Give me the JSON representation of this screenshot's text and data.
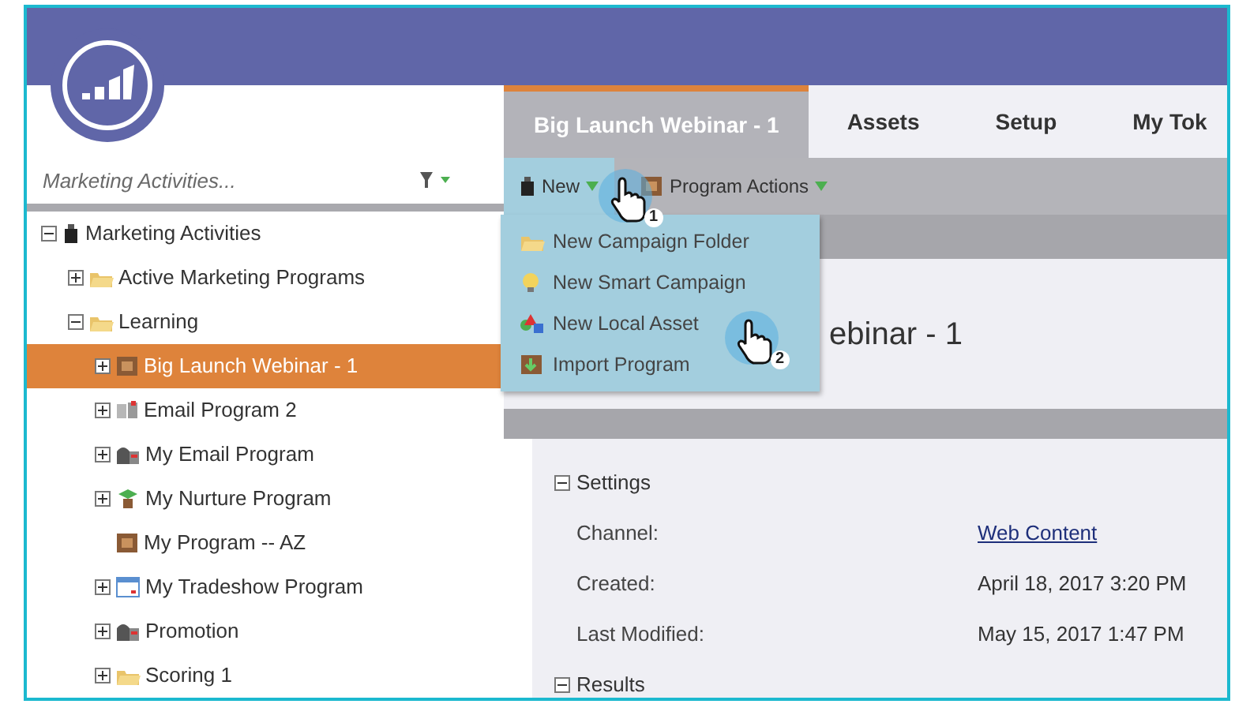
{
  "sidebar": {
    "search": {
      "placeholder": "Marketing Activities..."
    },
    "tree": [
      {
        "label": "Marketing Activities",
        "kind": "root",
        "expanded": true,
        "selected": false,
        "children": [
          {
            "label": "Active Marketing Programs",
            "kind": "folder",
            "expanded": false,
            "selected": false
          },
          {
            "label": "Learning",
            "kind": "folder",
            "expanded": true,
            "selected": false,
            "children": [
              {
                "label": "Big Launch Webinar - 1",
                "kind": "program",
                "expanded": false,
                "selected": true
              },
              {
                "label": "Email Program 2",
                "kind": "email-program",
                "expanded": false,
                "selected": false
              },
              {
                "label": "My Email Program",
                "kind": "mailbox",
                "expanded": false,
                "selected": false
              },
              {
                "label": "My Nurture Program",
                "kind": "nurture",
                "expanded": false,
                "selected": false
              },
              {
                "label": "My Program -- AZ",
                "kind": "program",
                "selected": false
              },
              {
                "label": "My Tradeshow Program",
                "kind": "event",
                "expanded": false,
                "selected": false
              },
              {
                "label": "Promotion",
                "kind": "mailbox",
                "expanded": false,
                "selected": false
              },
              {
                "label": "Scoring 1",
                "kind": "folder",
                "expanded": false,
                "selected": false
              }
            ]
          }
        ]
      }
    ]
  },
  "tabs": [
    {
      "label": "Big Launch Webinar - 1",
      "selected": true
    },
    {
      "label": "Assets",
      "selected": false
    },
    {
      "label": "Setup",
      "selected": false
    },
    {
      "label": "My Tok",
      "selected": false
    }
  ],
  "toolbar": [
    {
      "label": "New",
      "kind": "new",
      "open": true
    },
    {
      "label": "Program Actions",
      "kind": "program",
      "open": false
    }
  ],
  "menu": [
    {
      "label": "New Campaign Folder",
      "kind": "folder"
    },
    {
      "label": "New Smart Campaign",
      "kind": "bulb"
    },
    {
      "label": "New Local Asset",
      "kind": "asset"
    },
    {
      "label": "Import Program",
      "kind": "import"
    }
  ],
  "callouts": [
    {
      "number": "1"
    },
    {
      "number": "2"
    }
  ],
  "heading": "ebinar - 1",
  "settings": {
    "title": "Settings",
    "rows": [
      {
        "label": "Channel:",
        "value": "Web Content",
        "kind": "link"
      },
      {
        "label": "Created:",
        "value": "April 18, 2017 3:20 PM",
        "kind": "text"
      },
      {
        "label": "Last Modified:",
        "value": "May 15, 2017 1:47 PM",
        "kind": "text"
      }
    ]
  },
  "results": {
    "title": "Results"
  }
}
